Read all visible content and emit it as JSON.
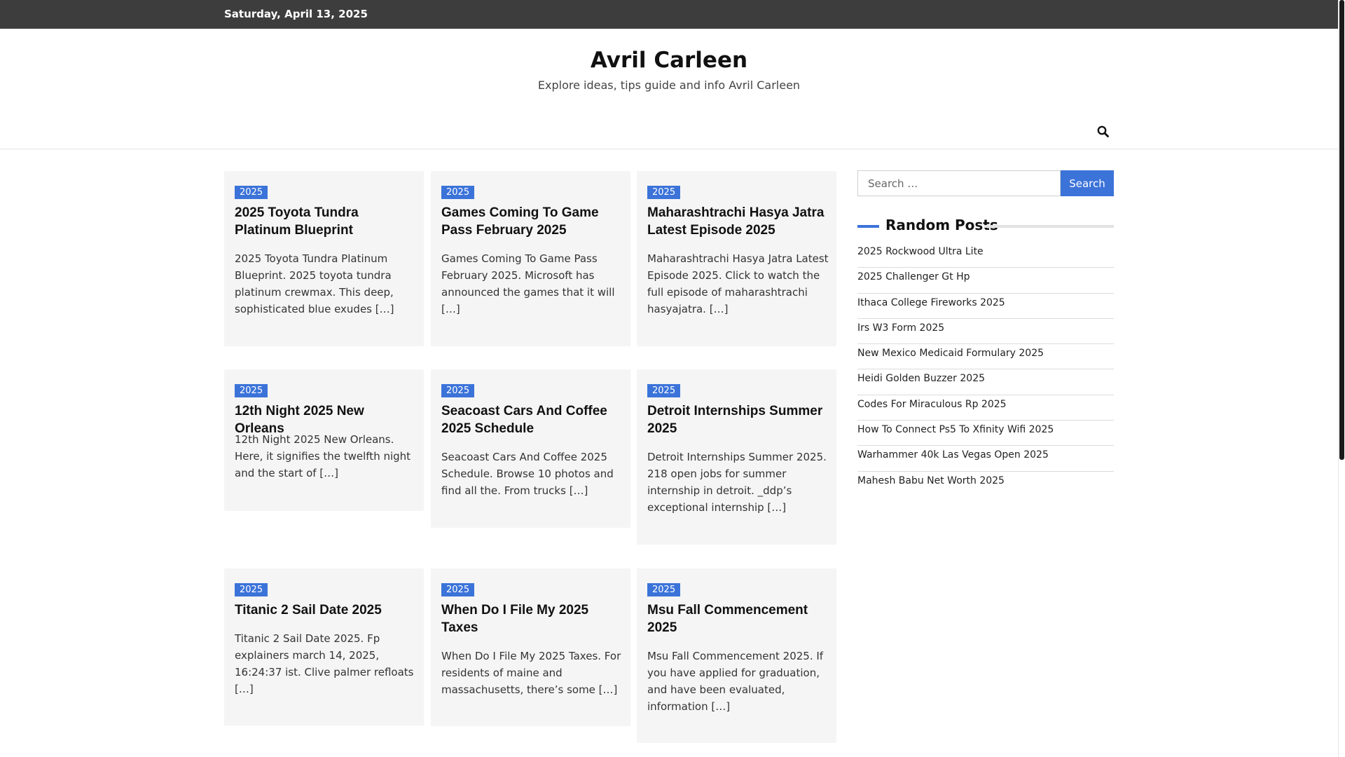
{
  "topbar": {
    "date": "Saturday, April 13, 2025"
  },
  "site": {
    "title": "Avril Carleen",
    "description": "Explore ideas, tips guide and info Avril Carleen"
  },
  "posts": [
    {
      "category": "2025",
      "title": "2025 Toyota Tundra Platinum Blueprint",
      "excerpt": "2025 Toyota Tundra Platinum Blueprint. 2025 toyota tundra platinum crewmax. This deep, sophisticated blue exudes […]"
    },
    {
      "category": "2025",
      "title": "Games Coming To Game Pass February 2025",
      "excerpt": "Games Coming To Game Pass February 2025. Microsoft has announced the games that it will […]"
    },
    {
      "category": "2025",
      "title": "Maharashtrachi Hasya Jatra Latest Episode 2025",
      "excerpt": "Maharashtrachi Hasya Jatra Latest Episode 2025. Click to watch the full episode of maharashtrachi hasyajatra. […]"
    },
    {
      "category": "2025",
      "title": "12th Night 2025 New Orleans",
      "excerpt": "12th Night 2025 New Orleans. Here, it signifies the twelfth night and the start of […]"
    },
    {
      "category": "2025",
      "title": "Seacoast Cars And Coffee 2025 Schedule",
      "excerpt": "Seacoast Cars And Coffee 2025 Schedule. Browse 10 photos and find all the. From trucks […]"
    },
    {
      "category": "2025",
      "title": "Detroit Internships Summer 2025",
      "excerpt": "Detroit Internships Summer 2025. 218 open jobs for summer internship in detroit. _ddp’s exceptional internship […]"
    },
    {
      "category": "2025",
      "title": "Titanic 2 Sail Date 2025",
      "excerpt": "Titanic 2 Sail Date 2025. Fp explainers march 14, 2025, 16:24:37 ist. Clive palmer refloats […]"
    },
    {
      "category": "2025",
      "title": "When Do I File My 2025 Taxes",
      "excerpt": "When Do I File My 2025 Taxes. For residents of maine and massachusetts, there’s some […]"
    },
    {
      "category": "2025",
      "title": "Msu Fall Commencement 2025",
      "excerpt": "Msu Fall Commencement 2025. If you have applied for graduation, and have been evaluated, information […]"
    }
  ],
  "sidebar": {
    "search_placeholder": "Search …",
    "search_button": "Search",
    "random_posts_title": "Random Posts",
    "random_posts": [
      "2025 Rockwood Ultra Lite",
      "2025 Challenger Gt Hp",
      "Ithaca College Fireworks 2025",
      "Irs W3 Form 2025",
      "New Mexico Medicaid Formulary 2025",
      "Heidi Golden Buzzer 2025",
      "Codes For Miraculous Rp 2025",
      "How To Connect Ps5 To Xfinity Wifi 2025",
      "Warhammer 40k Las Vegas Open 2025",
      "Mahesh Babu Net Worth 2025"
    ]
  },
  "icons": {
    "header_search": "search-icon"
  },
  "colors": {
    "accent": "#3b73d9",
    "topbar": "#3d3d3d",
    "card_bg": "#f5f5f5"
  }
}
